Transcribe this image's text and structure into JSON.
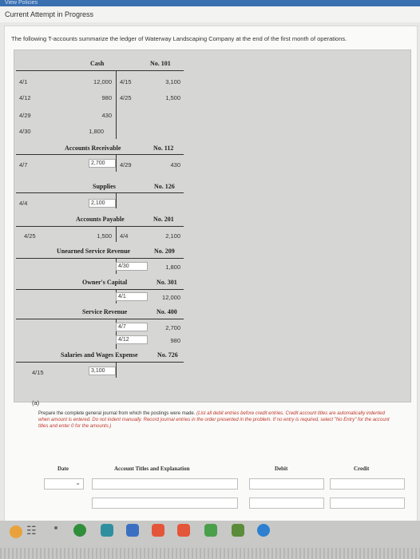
{
  "top_tab": "View Policies",
  "header_title": "Current Attempt in Progress",
  "intro": "The following T-accounts summarize the ledger of Waterway Landscaping Company at the end of the first month of operations.",
  "accounts": {
    "cash": {
      "name": "Cash",
      "no": "No. 101",
      "debits": [
        [
          "4/1",
          "12,000"
        ],
        [
          "4/12",
          "980"
        ],
        [
          "4/29",
          "430"
        ],
        [
          "4/30",
          "1,800"
        ]
      ],
      "credits": [
        [
          "4/15",
          "3,100"
        ],
        [
          "4/25",
          "1,500"
        ]
      ]
    },
    "ar": {
      "name": "Accounts Receivable",
      "no": "No. 112",
      "d_date": "4/7",
      "d_amt": "2,700",
      "c_date": "4/29",
      "c_amt": "430"
    },
    "sup": {
      "name": "Supplies",
      "no": "No. 126",
      "d_date": "4/4",
      "d_amt": "2,100"
    },
    "ap": {
      "name": "Accounts Payable",
      "no": "No. 201",
      "d_date": "4/25",
      "d_amt": "1,500",
      "c_date": "4/4",
      "c_amt": "2,100"
    },
    "usr": {
      "name": "Unearned Service Revenue",
      "no": "No. 209",
      "c_date": "4/30",
      "c_amt": "1,800"
    },
    "oc": {
      "name": "Owner's Capital",
      "no": "No. 301",
      "c_date": "4/1",
      "c_amt": "12,000"
    },
    "sr": {
      "name": "Service Revenue",
      "no": "No. 400",
      "c_date1": "4/7",
      "c_amt1": "2,700",
      "c_date2": "4/12",
      "c_amt2": "980"
    },
    "swe": {
      "name": "Salaries and Wages Expense",
      "no": "No. 726",
      "d_date": "4/15",
      "d_amt": "3,100"
    }
  },
  "part_label": "(a)",
  "instructions": "Prepare the complete general journal from which the postings were made.",
  "instructions_em": "(List all debit entries before credit entries. Credit account titles are automatically indented when amount is entered. Do not indent manually. Record journal entries in the order presented in the problem. If no entry is required, select \"No Entry\" for the account titles and enter 0 for the amounts.)",
  "journal_headers": {
    "date": "Date",
    "title": "Account Titles and Explanation",
    "debit": "Debit",
    "credit": "Credit"
  }
}
